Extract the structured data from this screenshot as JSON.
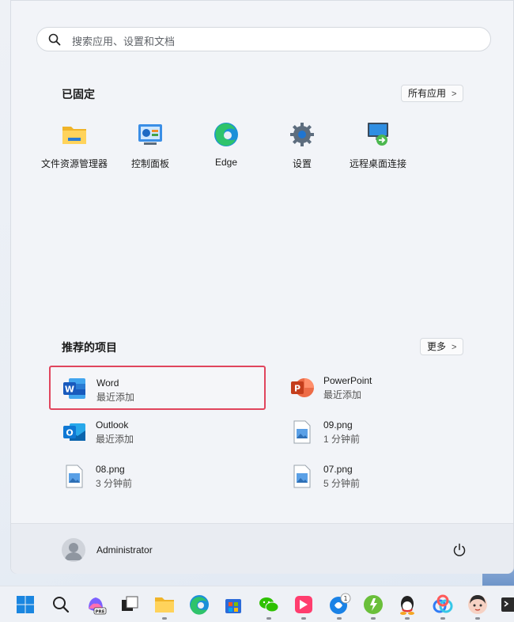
{
  "search": {
    "placeholder": "搜索应用、设置和文档"
  },
  "pinned": {
    "title": "已固定",
    "all_apps_label": "所有应用",
    "items": [
      {
        "label": "文件资源管理器",
        "icon": "folder-icon"
      },
      {
        "label": "控制面板",
        "icon": "control-panel-icon"
      },
      {
        "label": "Edge",
        "icon": "edge-icon"
      },
      {
        "label": "设置",
        "icon": "gear-icon"
      },
      {
        "label": "远程桌面连接",
        "icon": "remote-desktop-icon"
      }
    ]
  },
  "recommended": {
    "title": "推荐的项目",
    "more_label": "更多",
    "items": [
      {
        "name": "Word",
        "sub": "最近添加",
        "icon": "word-icon"
      },
      {
        "name": "PowerPoint",
        "sub": "最近添加",
        "icon": "powerpoint-icon"
      },
      {
        "name": "Outlook",
        "sub": "最近添加",
        "icon": "outlook-icon"
      },
      {
        "name": "09.png",
        "sub": "1 分钟前",
        "icon": "image-file-icon"
      },
      {
        "name": "08.png",
        "sub": "3 分钟前",
        "icon": "image-file-icon"
      },
      {
        "name": "07.png",
        "sub": "5 分钟前",
        "icon": "image-file-icon"
      }
    ]
  },
  "user": {
    "name": "Administrator"
  },
  "taskbar": {
    "badge_count": "1",
    "copilot_badge": "PRE",
    "icons": [
      "windows-start-icon",
      "search-icon",
      "copilot-icon",
      "task-view-icon",
      "file-explorer-icon",
      "edge-icon",
      "store-icon",
      "wechat-icon",
      "app-icon",
      "browser-icon",
      "green-app-icon",
      "qq-icon",
      "baidu-netdisk-icon",
      "avatar-app-icon",
      "terminal-icon"
    ]
  },
  "colors": {
    "selection_border": "#e0455d",
    "word_blue": "#185abd",
    "ppt_red": "#c43e1c"
  }
}
